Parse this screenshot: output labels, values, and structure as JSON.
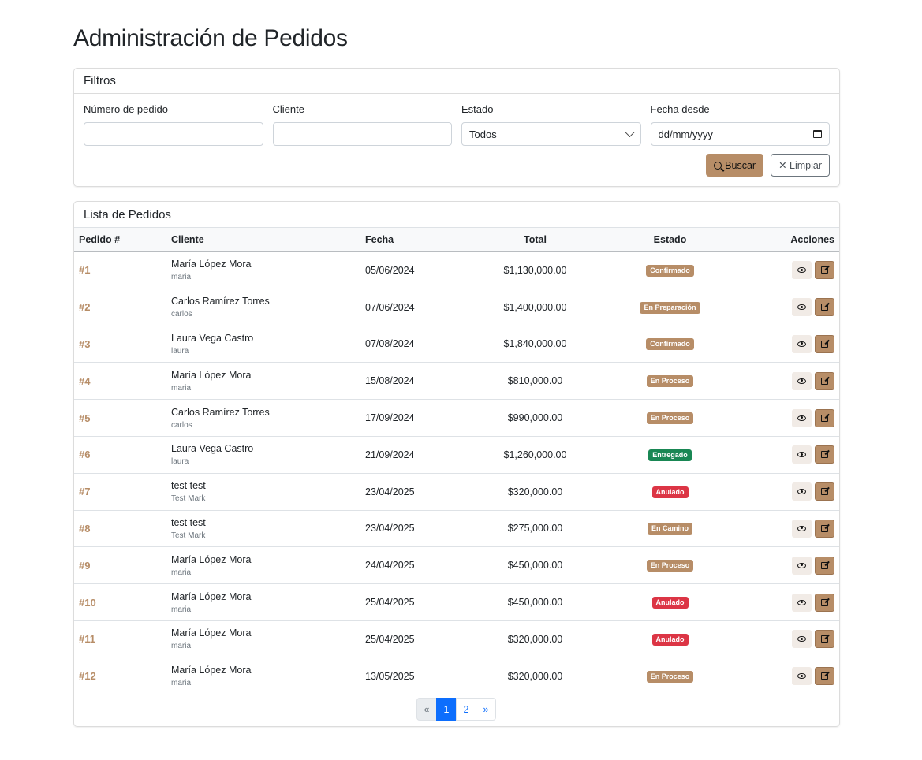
{
  "page": {
    "title": "Administración de Pedidos"
  },
  "filters": {
    "title": "Filtros",
    "order_number": {
      "label": "Número de pedido",
      "value": ""
    },
    "client": {
      "label": "Cliente",
      "value": ""
    },
    "status": {
      "label": "Estado",
      "selected": "Todos"
    },
    "date_from": {
      "label": "Fecha desde",
      "placeholder": "dd/mm/yyyy"
    },
    "search_label": "Buscar",
    "clear_label": "✕ Limpiar"
  },
  "orders": {
    "title": "Lista de Pedidos",
    "columns": [
      "Pedido #",
      "Cliente",
      "Fecha",
      "Total",
      "Estado",
      "Acciones"
    ],
    "status_colors": {
      "Confirmado": "#b78d67",
      "En Preparación": "#b78d67",
      "En Proceso": "#b78d67",
      "En Camino": "#b78d67",
      "Entregado": "#198754",
      "Anulado": "#dc3545"
    },
    "rows": [
      {
        "id": "#1",
        "client": "María López Mora",
        "user": "maria",
        "date": "05/06/2024",
        "total": "$1,130,000.00",
        "status": "Confirmado"
      },
      {
        "id": "#2",
        "client": "Carlos Ramírez Torres",
        "user": "carlos",
        "date": "07/06/2024",
        "total": "$1,400,000.00",
        "status": "En Preparación"
      },
      {
        "id": "#3",
        "client": "Laura Vega Castro",
        "user": "laura",
        "date": "07/08/2024",
        "total": "$1,840,000.00",
        "status": "Confirmado"
      },
      {
        "id": "#4",
        "client": "María López Mora",
        "user": "maria",
        "date": "15/08/2024",
        "total": "$810,000.00",
        "status": "En Proceso"
      },
      {
        "id": "#5",
        "client": "Carlos Ramírez Torres",
        "user": "carlos",
        "date": "17/09/2024",
        "total": "$990,000.00",
        "status": "En Proceso"
      },
      {
        "id": "#6",
        "client": "Laura Vega Castro",
        "user": "laura",
        "date": "21/09/2024",
        "total": "$1,260,000.00",
        "status": "Entregado"
      },
      {
        "id": "#7",
        "client": "test test",
        "user": "Test Mark",
        "date": "23/04/2025",
        "total": "$320,000.00",
        "status": "Anulado"
      },
      {
        "id": "#8",
        "client": "test test",
        "user": "Test Mark",
        "date": "23/04/2025",
        "total": "$275,000.00",
        "status": "En Camino"
      },
      {
        "id": "#9",
        "client": "María López Mora",
        "user": "maria",
        "date": "24/04/2025",
        "total": "$450,000.00",
        "status": "En Proceso"
      },
      {
        "id": "#10",
        "client": "María López Mora",
        "user": "maria",
        "date": "25/04/2025",
        "total": "$450,000.00",
        "status": "Anulado"
      },
      {
        "id": "#11",
        "client": "María López Mora",
        "user": "maria",
        "date": "25/04/2025",
        "total": "$320,000.00",
        "status": "Anulado"
      },
      {
        "id": "#12",
        "client": "María López Mora",
        "user": "maria",
        "date": "13/05/2025",
        "total": "$320,000.00",
        "status": "En Proceso"
      }
    ]
  },
  "pagination": {
    "prev": "«",
    "pages": [
      "1",
      "2"
    ],
    "active": "1",
    "next": "»"
  }
}
